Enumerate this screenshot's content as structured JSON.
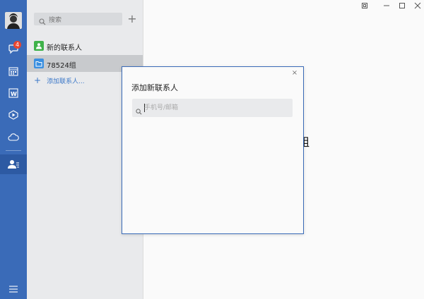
{
  "rail": {
    "badge_count": "4",
    "icons": [
      "chat-icon",
      "calendar-icon",
      "word-doc-icon",
      "video-icon",
      "cloud-icon",
      "contacts-icon",
      "menu-icon"
    ]
  },
  "list": {
    "search_placeholder": "搜索",
    "plus_label": "+",
    "items": [
      {
        "label": "新的联系人",
        "icon": "new-contact-icon",
        "color": "#3fb24a"
      },
      {
        "label": "78524组",
        "icon": "folder-icon",
        "color": "#3a8fe0"
      }
    ],
    "add_contact_label": "添加联系人..."
  },
  "background_fragment": "组",
  "dialog": {
    "title": "添加新联系人",
    "search_placeholder": "手机号/邮箱",
    "close_label": "×"
  },
  "colors": {
    "rail": "#3a6bb8",
    "accent_link": "#3c78c8",
    "badge": "#e8452f"
  }
}
